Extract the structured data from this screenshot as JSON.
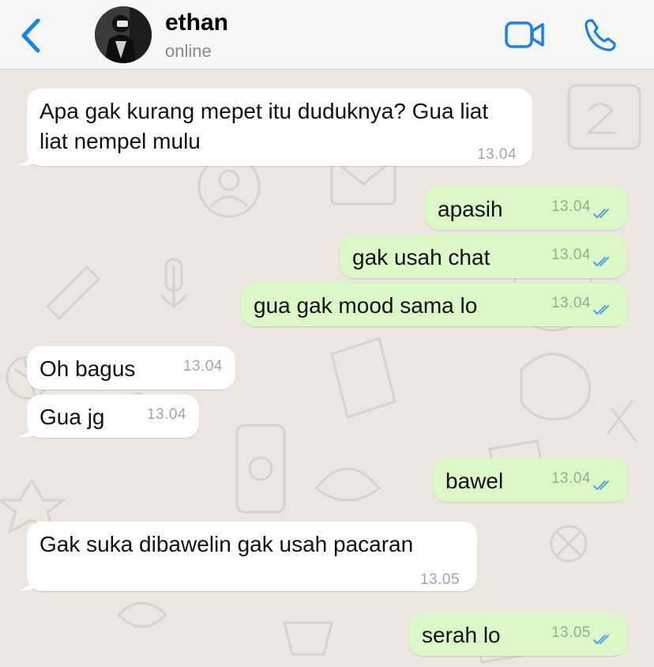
{
  "header": {
    "contact_name": "ethan",
    "contact_status": "online"
  },
  "messages": [
    {
      "direction": "in",
      "text": "Apa gak kurang mepet itu duduknya? Gua liat liat nempel mulu",
      "time": "13.04"
    },
    {
      "direction": "out",
      "text": "apasih",
      "time": "13.04",
      "read": true
    },
    {
      "direction": "out",
      "text": "gak usah chat",
      "time": "13.04",
      "read": true
    },
    {
      "direction": "out",
      "text": "gua gak mood sama lo",
      "time": "13.04",
      "read": true
    },
    {
      "direction": "in",
      "text": "Oh bagus",
      "time": "13.04"
    },
    {
      "direction": "in",
      "text": "Gua jg",
      "time": "13.04"
    },
    {
      "direction": "out",
      "text": "bawel",
      "time": "13.04",
      "read": true
    },
    {
      "direction": "in",
      "text": "Gak suka dibawelin gak usah pacaran",
      "time": "13.05"
    },
    {
      "direction": "out",
      "text": "serah lo",
      "time": "13.05",
      "read": true
    }
  ],
  "colors": {
    "accent": "#1a82e2",
    "outgoing_bubble": "#dcf8c6",
    "incoming_bubble": "#ffffff",
    "read_ticks": "#4fa3e8",
    "wallpaper": "#ebe6df"
  },
  "icons": [
    "back-chevron-icon",
    "video-call-icon",
    "voice-call-icon",
    "double-check-icon"
  ]
}
